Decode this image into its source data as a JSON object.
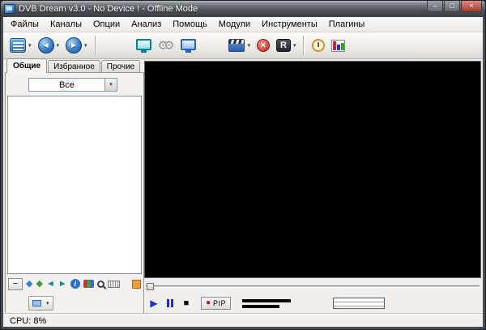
{
  "window": {
    "title": "DVB Dream v3.0 - No Device ! - Offline Mode",
    "controls": {
      "minimize": "–",
      "maximize": "□",
      "close": "×"
    }
  },
  "menubar": {
    "items": [
      {
        "label": "Файлы"
      },
      {
        "label": "Каналы"
      },
      {
        "label": "Опции"
      },
      {
        "label": "Анализ"
      },
      {
        "label": "Помощь"
      },
      {
        "label": "Модули"
      },
      {
        "label": "Инструменты"
      },
      {
        "label": "Плагины"
      }
    ]
  },
  "toolbar": {
    "record_letter": "R"
  },
  "glyphs": {
    "dropdown": "▾",
    "back": "◄",
    "forward": "►",
    "gear": "⚙",
    "delete": "×",
    "minus": "−",
    "diamond": "◆",
    "arrow_left": "◄",
    "arrow_right": "►",
    "info": "i",
    "play": "▶",
    "stop": "■",
    "record_dot": "●"
  },
  "sidebar": {
    "tabs": [
      {
        "label": "Общие"
      },
      {
        "label": "Избранное"
      },
      {
        "label": "Прочие"
      }
    ],
    "filter_combo": {
      "value": "Все"
    }
  },
  "player": {
    "pip_label": "PIP"
  },
  "statusbar": {
    "cpu": "CPU: 8%"
  },
  "colors": {
    "accent_blue": "#2e7cc9",
    "record_red": "#d01010",
    "video_bg": "#000000"
  }
}
